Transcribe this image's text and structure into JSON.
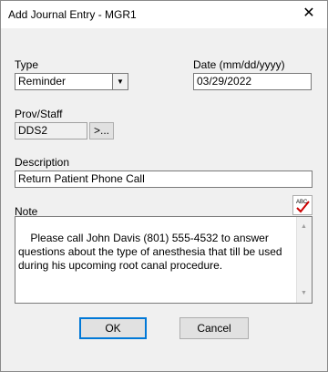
{
  "window": {
    "title": "Add Journal Entry - MGR1",
    "close_glyph": "✕"
  },
  "type": {
    "label": "Type",
    "value": "Reminder",
    "arrow": "▼"
  },
  "date": {
    "label": "Date (mm/dd/yyyy)",
    "value": "03/29/2022"
  },
  "prov": {
    "label": "Prov/Staff",
    "value": "DDS2",
    "button_label": ">..."
  },
  "description": {
    "label": "Description",
    "value": "Return Patient Phone Call"
  },
  "note": {
    "label": "Note",
    "value": "Please call John Davis (801) 555-4532 to answer questions about the type of anesthesia that till be used during his upcoming root canal procedure.",
    "spell_icon": "spell-check-icon"
  },
  "buttons": {
    "ok": "OK",
    "cancel": "Cancel"
  },
  "colors": {
    "focus": "#0078d7",
    "spell_check": "#cc0000"
  }
}
